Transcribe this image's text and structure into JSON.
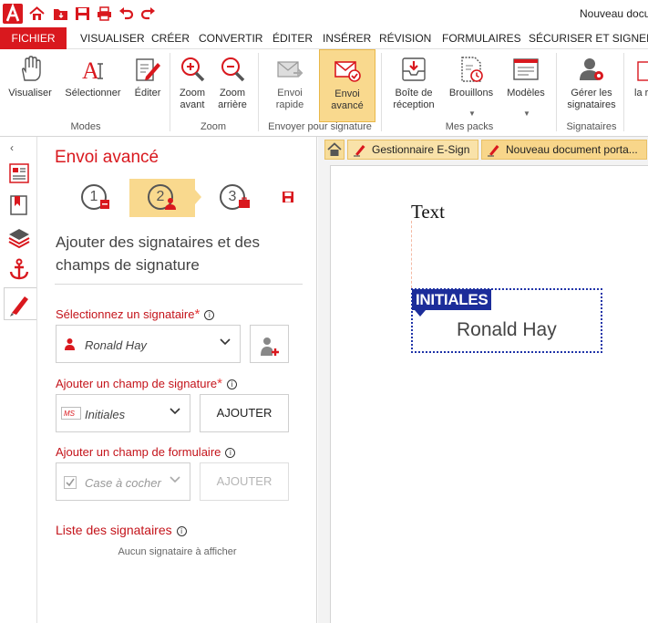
{
  "window": {
    "document_title": "Nouveau docum"
  },
  "menu": {
    "items": [
      "FICHIER",
      "VISUALISER",
      "CRÉER",
      "CONVERTIR",
      "ÉDITER",
      "INSÉRER",
      "RÉVISION",
      "FORMULAIRES",
      "SÉCURISER ET SIGNER"
    ]
  },
  "ribbon": {
    "buttons": {
      "visualiser": "Visualiser",
      "selectionner": "Sélectionner",
      "editer": "Éditer",
      "zoom_in_1": "Zoom",
      "zoom_in_2": "avant",
      "zoom_out_1": "Zoom",
      "zoom_out_2": "arrière",
      "envoi_rapide_1": "Envoi",
      "envoi_rapide_2": "rapide",
      "envoi_avance_1": "Envoi",
      "envoi_avance_2": "avancé",
      "boite_1": "Boîte de",
      "boite_2": "réception",
      "brouillons": "Brouillons",
      "modeles": "Modèles",
      "gerer_1": "Gérer les",
      "gerer_2": "signataires",
      "cut_off": "la r"
    },
    "groups": {
      "modes": "Modes",
      "zoom": "Zoom",
      "envoyer": "Envoyer pour signature",
      "mespacks": "Mes packs",
      "signataires": "Signataires"
    }
  },
  "panel": {
    "title": "Envoi avancé",
    "steps": [
      "1",
      "2",
      "3"
    ],
    "section_desc": "Ajouter des signataires et des champs de signature",
    "select_signer_label": "Sélectionnez un signataire",
    "selected_signer": "Ronald Hay",
    "add_sig_field_label": "Ajouter un champ de signature",
    "sig_field_type": "Initiales",
    "add_button": "AJOUTER",
    "add_form_field_label": "Ajouter un champ de formulaire",
    "form_field_type": "Case à cocher",
    "add_button_disabled": "AJOUTER",
    "signers_list_label": "Liste des signataires",
    "no_signers": "Aucun signataire à afficher"
  },
  "doc_tabs": [
    "Gestionnaire E-Sign",
    "Nouveau document porta..."
  ],
  "document": {
    "text": "Text",
    "sig_tag": "INITIALES",
    "sig_signer": "Ronald Hay"
  },
  "colors": {
    "accent": "#d9181e",
    "active_tab": "#f9d98e",
    "sig_blue": "#1c2d9a"
  }
}
